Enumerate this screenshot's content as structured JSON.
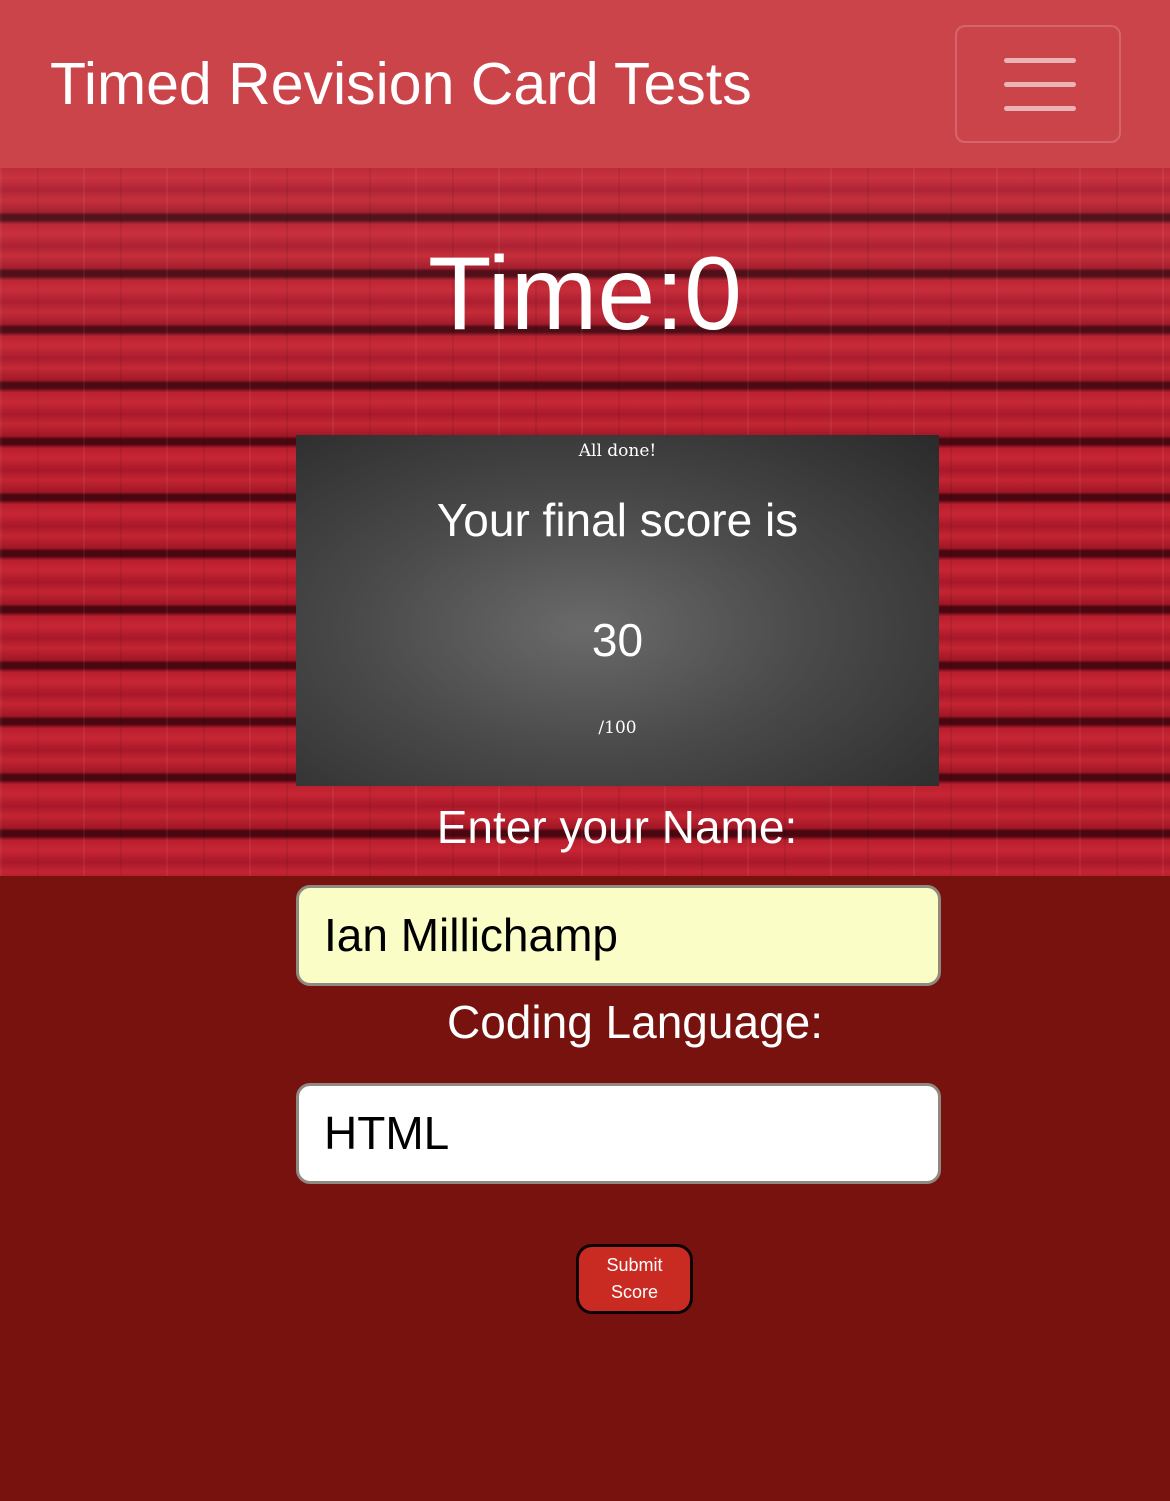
{
  "navbar": {
    "brand": "Timed Revision Card Tests",
    "toggler_icon": "hamburger-menu-icon"
  },
  "timer": {
    "text": "Time:0"
  },
  "result_card": {
    "heading": "All done!",
    "message": "Your final score is",
    "score": "30",
    "out_of": "/100"
  },
  "form": {
    "name_label": "Enter your Name:",
    "name_value": "Ian Millichamp",
    "language_label": "Coding Language:",
    "language_value": "HTML",
    "submit_line1": "Submit",
    "submit_line2": "Score"
  },
  "colors": {
    "navbar": "#cb444a",
    "page_background": "#78120e",
    "submit_button": "#c92a22",
    "name_field": "#fafdc6"
  }
}
